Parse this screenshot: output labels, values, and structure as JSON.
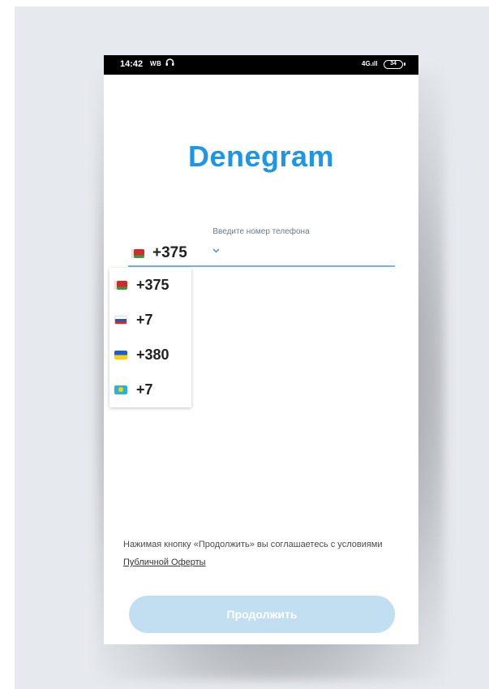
{
  "status_bar": {
    "time": "14:42",
    "wb": "WB",
    "headset_icon": "headset-icon",
    "signal": "4G.ıll",
    "battery": "34"
  },
  "logo": "Denegram",
  "phone_input": {
    "label": "Введите номер телефона",
    "selected_code": "+375",
    "selected_flag": "belarus-flag-icon"
  },
  "country_dropdown": {
    "items": [
      {
        "code": "+375",
        "flag": "belarus-flag-icon"
      },
      {
        "code": "+7",
        "flag": "russia-flag-icon"
      },
      {
        "code": "+380",
        "flag": "ukraine-flag-icon"
      },
      {
        "code": "+7",
        "flag": "kazakhstan-flag-icon"
      }
    ]
  },
  "terms": {
    "text": "Нажимая кнопку «Продолжить» вы соглашаетесь с условиями ",
    "link": "Публичной Оферты"
  },
  "continue_button": {
    "label": "Продолжить",
    "color": "#c2dff2"
  },
  "colors": {
    "brand": "#1e96e6",
    "underline": "#79aee8",
    "status_bar": "#000000"
  }
}
